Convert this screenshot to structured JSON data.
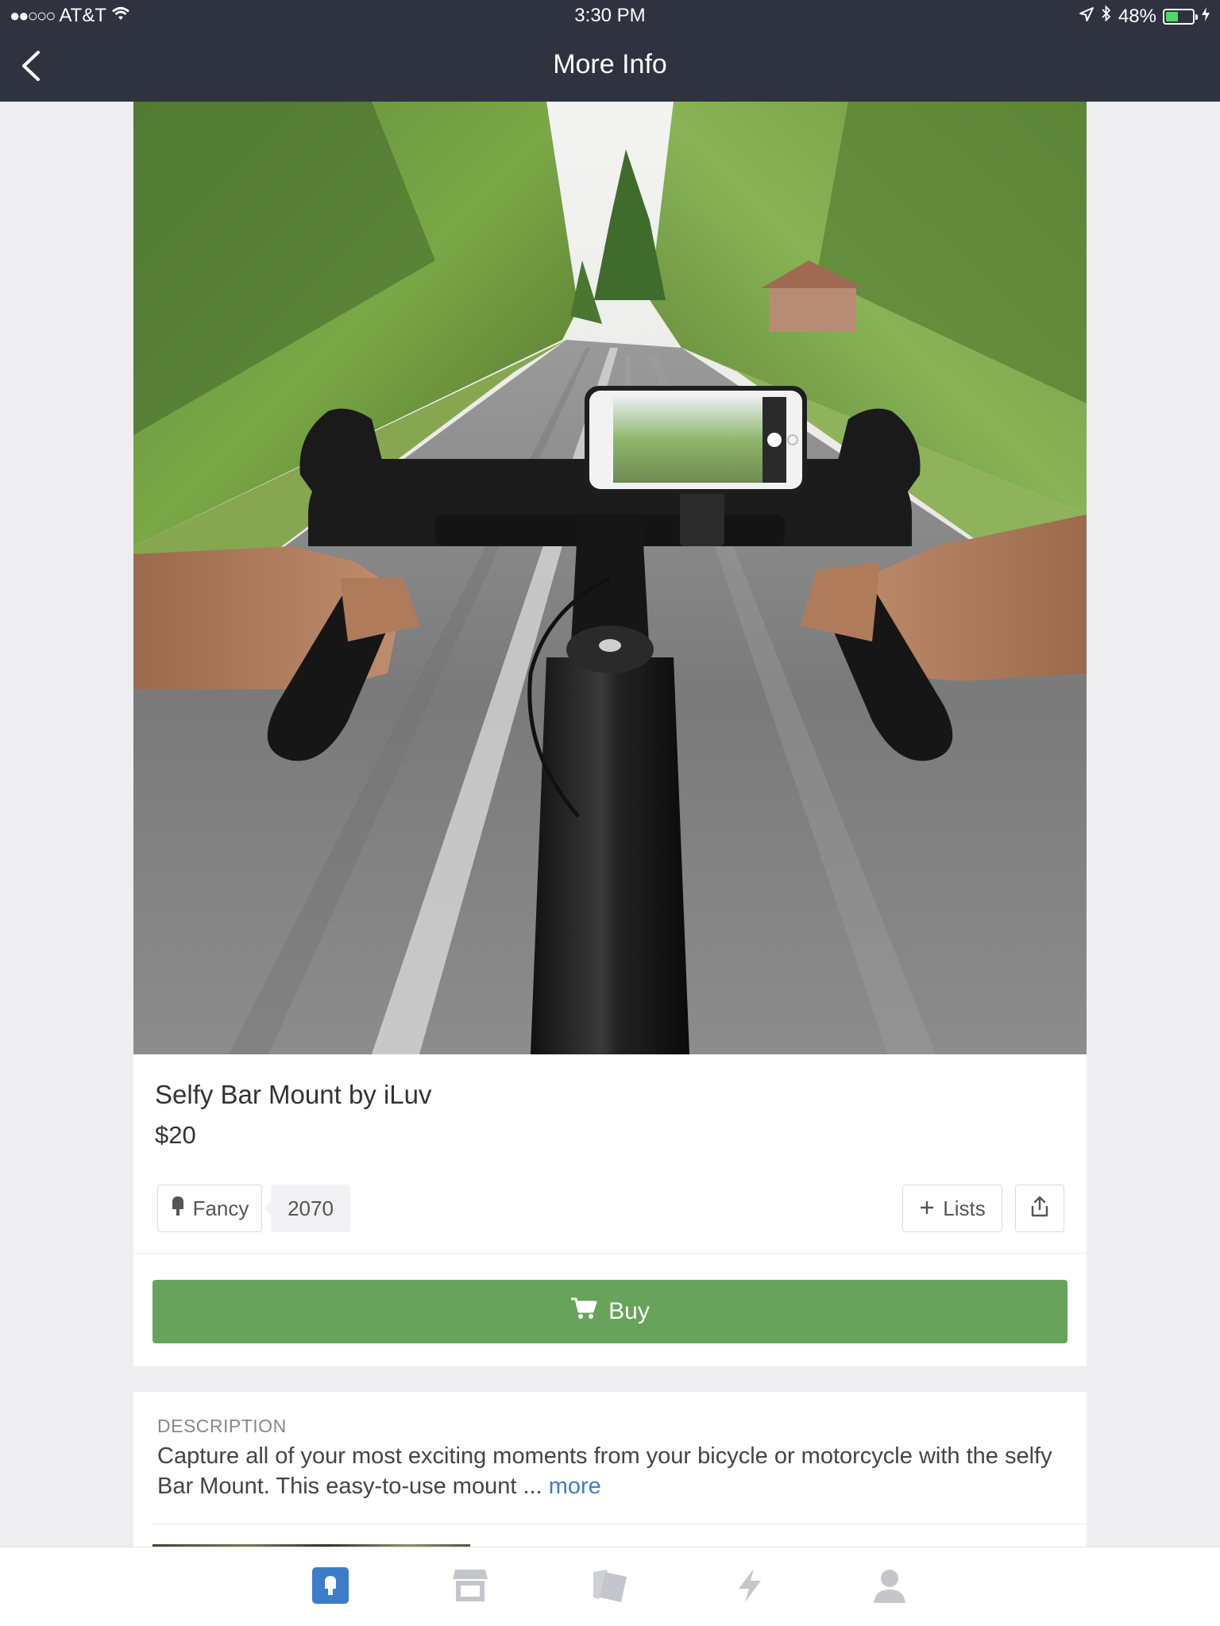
{
  "status_bar": {
    "signal": "●●○○○",
    "carrier": "AT&T",
    "time": "3:30 PM",
    "battery": "48%",
    "battery_level": 0.48
  },
  "nav": {
    "title": "More Info",
    "back_icon": "chevron-left-icon"
  },
  "product": {
    "title": "Selfy Bar Mount by iLuv",
    "price": "$20",
    "fancy_label": "Fancy",
    "fancy_count": "2070",
    "lists_label": "Lists",
    "buy_label": "Buy"
  },
  "description": {
    "heading": "DESCRIPTION",
    "text": "Capture all of your most exciting moments from your bicycle or motorcycle with the selfy Bar Mount. This easy-to-use mount ... ",
    "more_label": "more"
  },
  "tabbar": {
    "items": [
      {
        "icon": "fancy-tag-icon",
        "active": true
      },
      {
        "icon": "store-icon",
        "active": false
      },
      {
        "icon": "cards-icon",
        "active": false
      },
      {
        "icon": "lightning-icon",
        "active": false
      },
      {
        "icon": "person-icon",
        "active": false
      }
    ]
  },
  "colors": {
    "navbar": "#2f3340",
    "buy_button": "#67a35a",
    "link": "#3d7cc9",
    "active_tab": "#3d7cc9",
    "inactive_tab": "#c4c6cc"
  }
}
